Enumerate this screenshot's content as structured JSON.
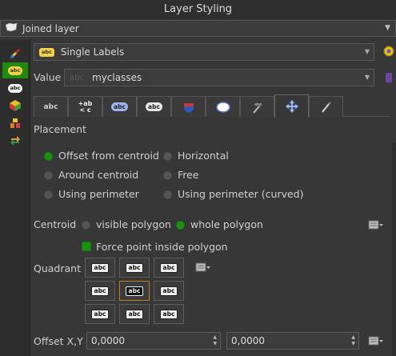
{
  "window": {
    "title": "Layer Styling"
  },
  "layer_select": {
    "value": "Joined layer"
  },
  "label_mode": {
    "value": "Single Labels"
  },
  "value_field": {
    "label": "Value",
    "value": "myclasses"
  },
  "tabs": [
    {
      "icon": "text-icon"
    },
    {
      "icon": "formatting-icon"
    },
    {
      "icon": "buffer-icon"
    },
    {
      "icon": "background-icon"
    },
    {
      "icon": "shadow-icon"
    },
    {
      "icon": "callout-icon"
    },
    {
      "icon": "rendering-icon"
    },
    {
      "icon": "placement-icon"
    },
    {
      "icon": "rendering-pen-icon"
    }
  ],
  "placement": {
    "heading": "Placement",
    "options": {
      "offset_from_centroid": "Offset from centroid",
      "horizontal": "Horizontal",
      "around_centroid": "Around centroid",
      "free": "Free",
      "using_perimeter": "Using perimeter",
      "using_perimeter_curved": "Using perimeter (curved)"
    },
    "selected": "Offset from centroid"
  },
  "centroid": {
    "label": "Centroid",
    "visible_polygon": "visible polygon",
    "whole_polygon": "whole polygon",
    "selected": "whole polygon"
  },
  "force_inside": {
    "label": "Force point inside polygon",
    "checked": true
  },
  "quadrant": {
    "label": "Quadrant",
    "tag_text": "abc",
    "selected": "center"
  },
  "offset": {
    "label": "Offset X,Y",
    "x": "0,0000",
    "y": "0,0000"
  },
  "colors": {
    "accent_green": "#1d8f13",
    "selected_border": "#c57e26"
  }
}
